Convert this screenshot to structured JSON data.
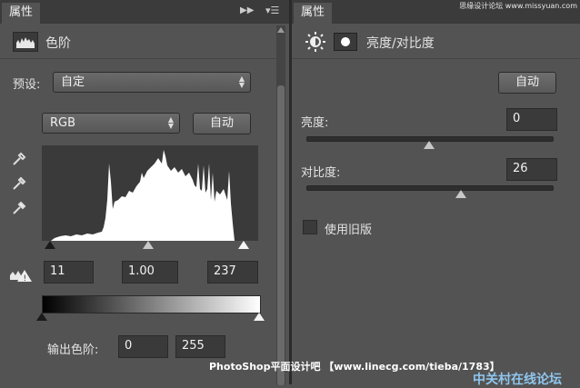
{
  "left_panel": {
    "tab_label": "属性",
    "title": "色阶",
    "preset_label": "预设:",
    "preset_value": "自定",
    "channel_value": "RGB",
    "auto_label": "自动",
    "input_levels": {
      "black": "11",
      "gamma": "1.00",
      "white": "237"
    },
    "output_label": "输出色阶:",
    "output_levels": {
      "black": "0",
      "white": "255"
    }
  },
  "right_panel": {
    "tab_label": "属性",
    "title": "亮度/对比度",
    "auto_label": "自动",
    "brightness_label": "亮度:",
    "brightness_value": "0",
    "contrast_label": "对比度:",
    "contrast_value": "26",
    "legacy_label": "使用旧版",
    "legacy_checked": false
  },
  "watermarks": {
    "top_right": "思缘设计论坛 www.missyuan.com",
    "bottom": "PhotoShop平面设计吧 【www.linecg.com/tieba/1783】",
    "corner": "中关村在线论坛"
  },
  "icons": [
    "levels-icon",
    "eyedropper-black-icon",
    "eyedropper-gray-icon",
    "eyedropper-white-icon",
    "clipping-warning-icon",
    "brightness-icon",
    "mask-icon",
    "panel-menu-icon",
    "collapse-icon"
  ]
}
